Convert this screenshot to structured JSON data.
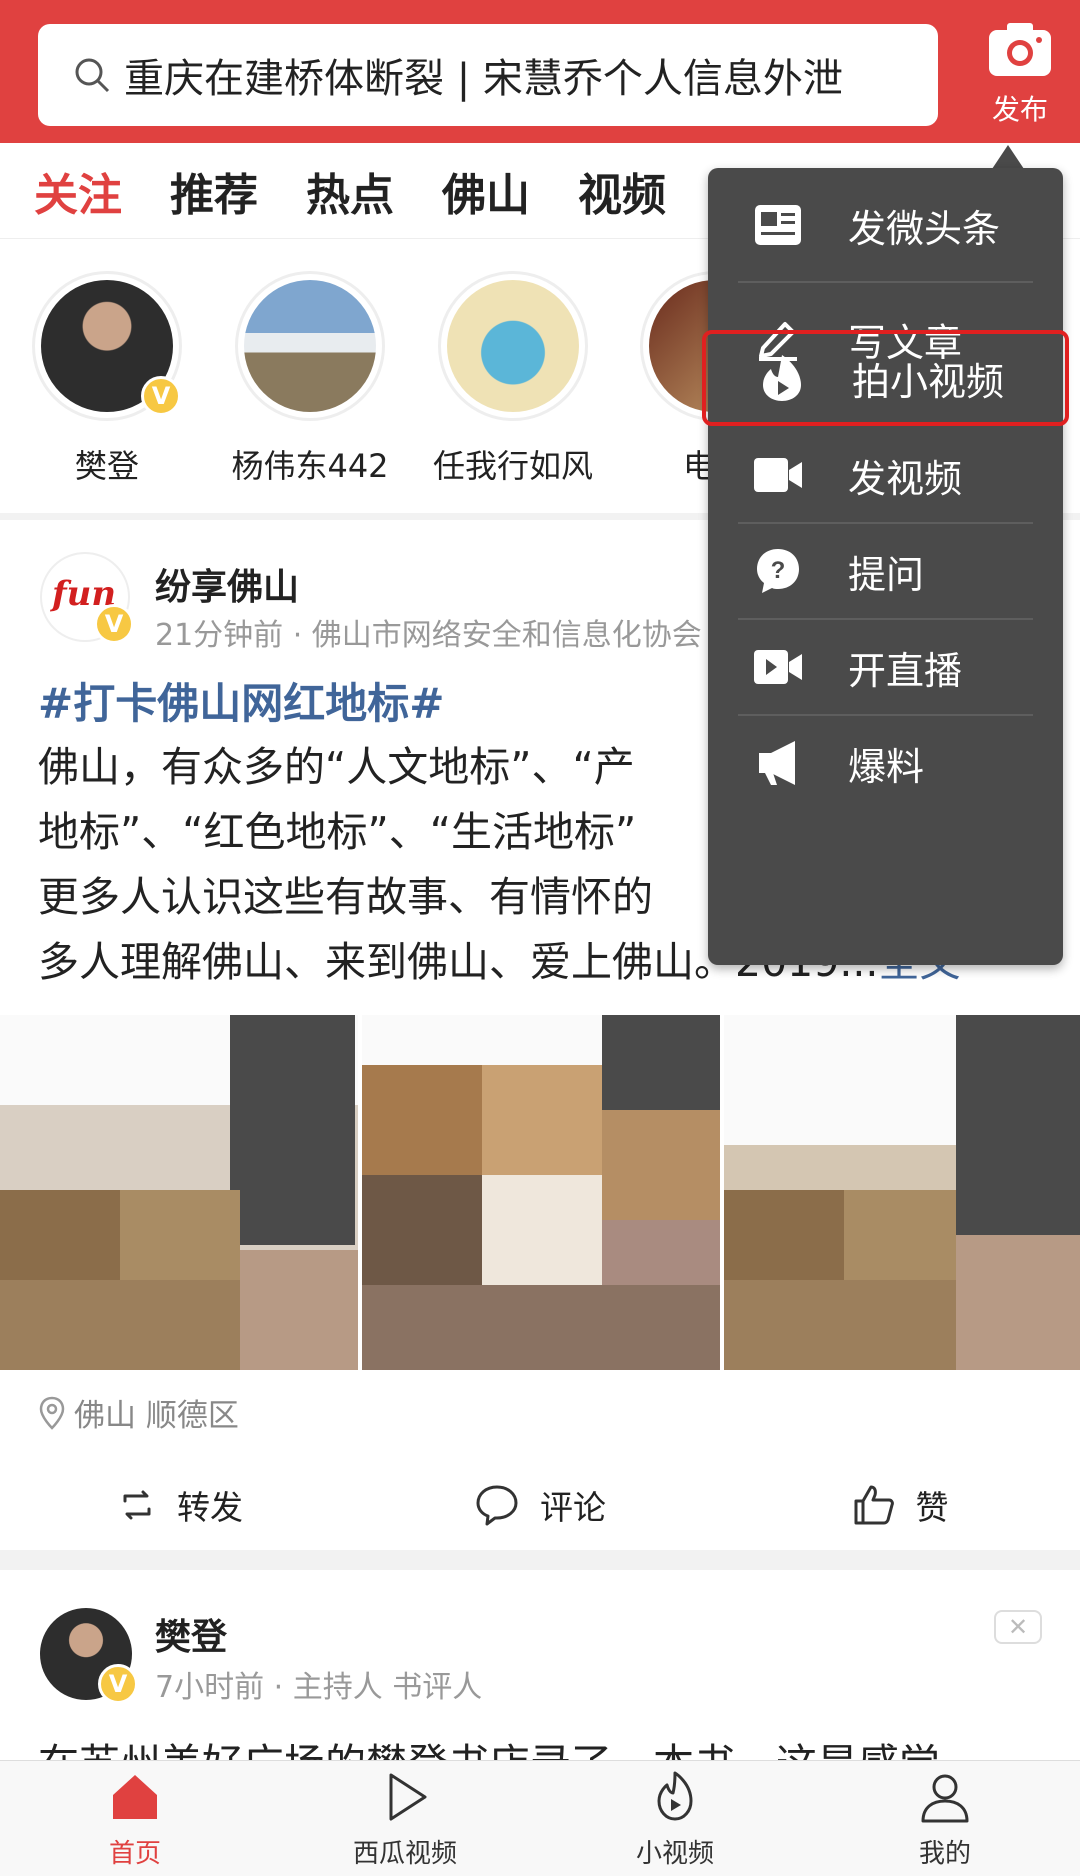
{
  "search": {
    "text": "重庆在建桥体断裂 | 宋慧乔个人信息外泄"
  },
  "publish": {
    "label": "发布"
  },
  "tabs": [
    "关注",
    "推荐",
    "热点",
    "佛山",
    "视频"
  ],
  "following": [
    {
      "name": "樊登"
    },
    {
      "name": "杨伟东442"
    },
    {
      "name": "任我行如风"
    },
    {
      "name": "电商"
    }
  ],
  "post1": {
    "author": "纷享佛山",
    "meta": "21分钟前 · 佛山市网络安全和信息化协会",
    "hashtag": "#打卡佛山网红地标#",
    "body_lines": [
      "佛山，有众多的“人文地标”、“产",
      "地标”、“红色地标”、“生活地标”",
      "更多人认识这些有故事、有情怀的",
      "多人理解佛山、来到佛山、爱上佛山。2019..."
    ],
    "more": "全文",
    "location": "佛山 顺德区",
    "actions": {
      "share": "转发",
      "comment": "评论",
      "like": "赞"
    }
  },
  "post2": {
    "author": "樊登",
    "meta": "7小时前 · 主持人 书评人",
    "text": "在苏州美好广场的樊登书店录了一本书，这是感觉"
  },
  "popup_menu": [
    {
      "label": "发微头条",
      "icon": "micro-post-icon"
    },
    {
      "label": "写文章",
      "icon": "pen-icon"
    },
    {
      "label": "拍小视频",
      "icon": "short-video-icon",
      "highlighted": true
    },
    {
      "label": "发视频",
      "icon": "video-camera-icon"
    },
    {
      "label": "提问",
      "icon": "question-icon"
    },
    {
      "label": "开直播",
      "icon": "live-icon"
    },
    {
      "label": "爆料",
      "icon": "megaphone-icon"
    }
  ],
  "bottom_nav": [
    {
      "label": "首页",
      "icon": "home-icon",
      "active": true
    },
    {
      "label": "西瓜视频",
      "icon": "play-icon"
    },
    {
      "label": "小视频",
      "icon": "short-video-icon"
    },
    {
      "label": "我的",
      "icon": "user-icon"
    }
  ],
  "colors": {
    "brand_red": "#e04140",
    "menu_bg": "#4a4a4a",
    "link_blue": "#406599"
  }
}
